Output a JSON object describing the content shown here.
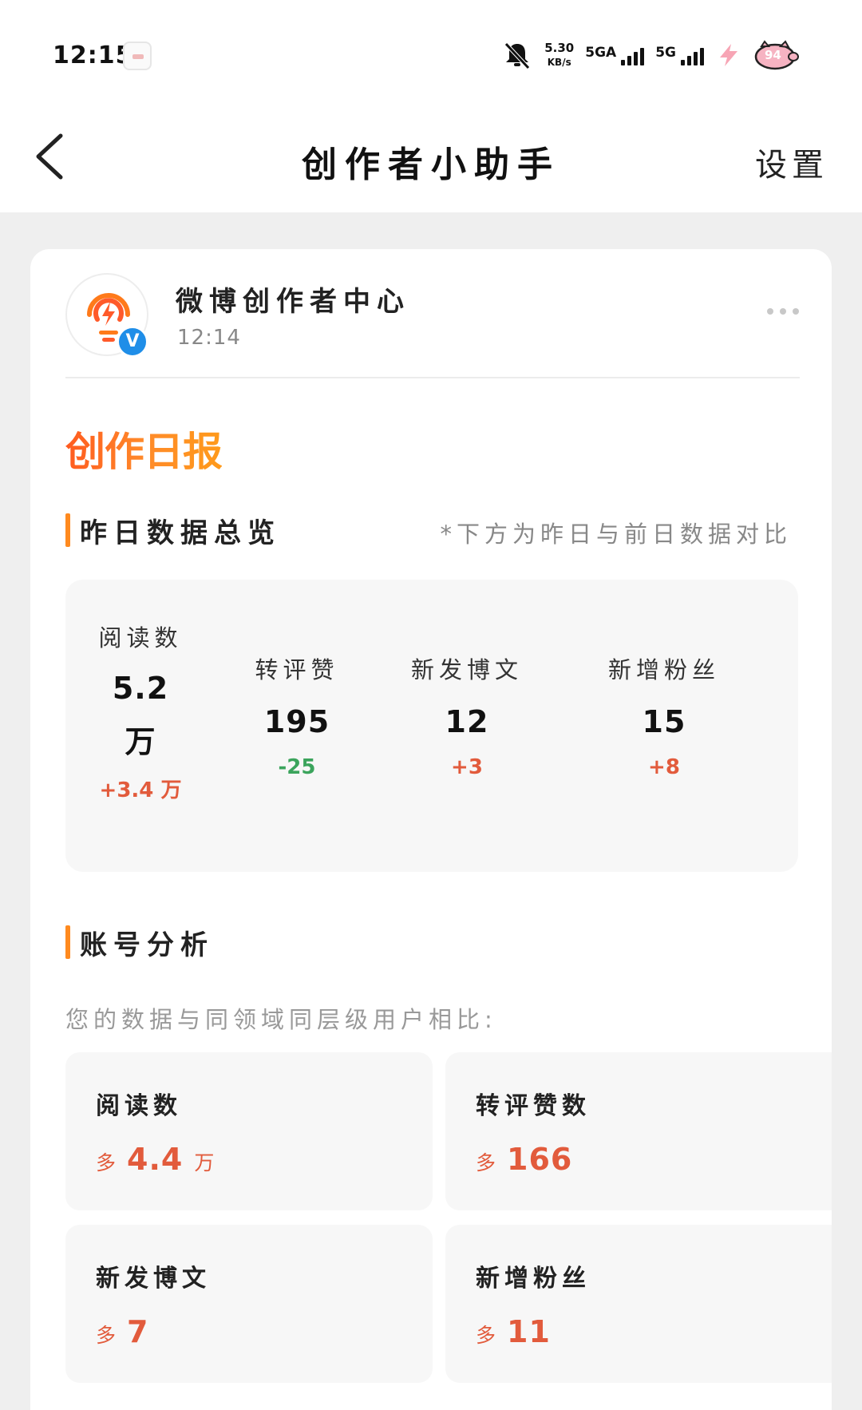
{
  "status_bar": {
    "time": "12:15",
    "net_speed_value": "5.30",
    "net_speed_unit": "KB/s",
    "signal_1_label": "5GA",
    "signal_2_label": "5G",
    "battery_level": "94",
    "icons": [
      "app-notification-icon",
      "silent-bell-icon",
      "wifi-speed",
      "signal-icon",
      "charging-icon",
      "battery-icon"
    ]
  },
  "nav": {
    "title": "创作者小助手",
    "settings_label": "设置"
  },
  "message": {
    "sender_name": "微博创作者中心",
    "sender_time": "12:14",
    "verified_mark": "V",
    "report_title": "创作日报"
  },
  "overview": {
    "title": "昨日数据总览",
    "note": "*下方为昨日与前日数据对比",
    "reads": {
      "label": "阅读数",
      "value_num": "5.2",
      "value_unit": "万",
      "delta": "+3.4 万"
    },
    "interactions": {
      "label": "转评赞",
      "value": "195",
      "delta": "-25"
    },
    "posts": {
      "label": "新发博文",
      "value": "12",
      "delta": "+3"
    },
    "fans": {
      "label": "新增粉丝",
      "value": "15",
      "delta": "+8"
    }
  },
  "analysis": {
    "title": "账号分析",
    "subtitle": "您的数据与同领域同层级用户相比:",
    "more_word": "多",
    "reads": {
      "label": "阅读数",
      "value": "4.4",
      "unit": "万"
    },
    "interactions": {
      "label": "转评赞数",
      "value": "166"
    },
    "posts": {
      "label": "新发博文",
      "value": "7"
    },
    "fans": {
      "label": "新增粉丝",
      "value": "11"
    }
  },
  "colors": {
    "accent_orange": "#ff8a1f",
    "increase_red": "#e25b3c",
    "decrease_green": "#3ba45c",
    "verified_blue": "#1f8ee8"
  }
}
